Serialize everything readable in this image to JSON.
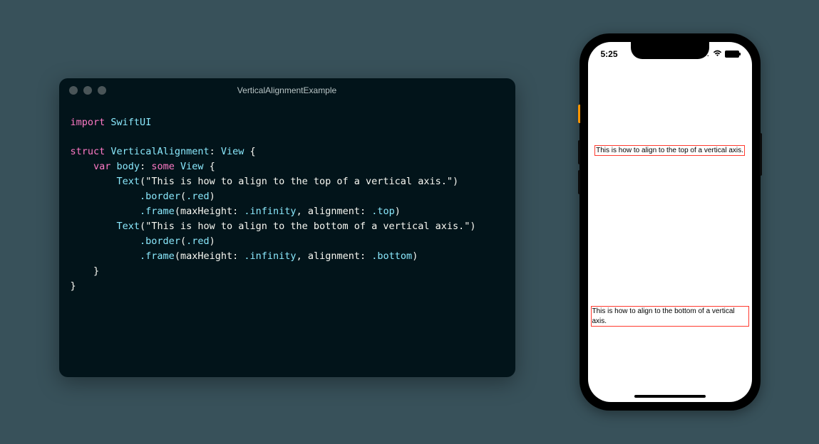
{
  "editor": {
    "title": "VerticalAlignmentExample",
    "code": {
      "import_kw": "import",
      "swiftui": "SwiftUI",
      "struct_kw": "struct",
      "struct_name": "VerticalAlignment",
      "view": "View",
      "var_kw": "var",
      "body": "body",
      "some_kw": "some",
      "text_fn": "Text",
      "string1": "\"This is how to align to the top of a vertical axis.\"",
      "string2": "\"This is how to align to the bottom of a vertical axis.\"",
      "border": ".border",
      "red": ".red",
      "frame": ".frame",
      "maxHeight": "maxHeight",
      "infinity": ".infinity",
      "alignment": "alignment",
      "top": ".top",
      "bottom": ".bottom"
    }
  },
  "phone": {
    "time": "5:25",
    "signal": "....",
    "top_text": "This is how to align to the top of a vertical axis.",
    "bottom_text": "This is how to align to the bottom of a vertical axis."
  }
}
